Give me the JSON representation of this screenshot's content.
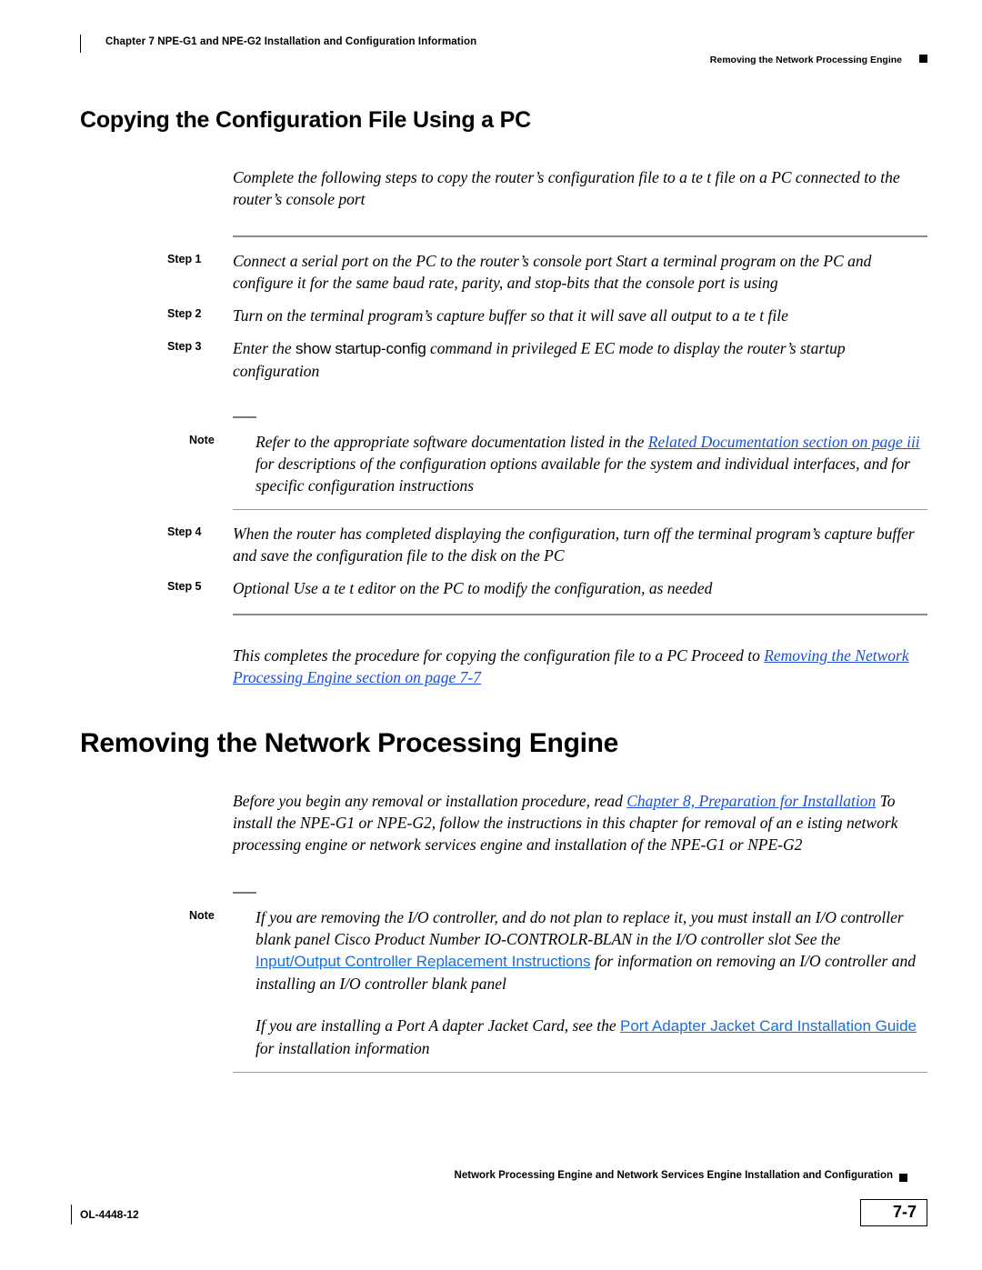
{
  "header": {
    "chapter": "Chapter 7      NPE-G1 and NPE-G2 Installation and Configuration Information",
    "running_head": "Removing the Network Processing Engine"
  },
  "section1": {
    "title": "Copying the Configuration File Using a PC",
    "intro": "Complete the following steps to copy the router’s configuration file to a te t file on a PC connected to the router’s console port",
    "steps": [
      {
        "label": "Step 1",
        "text": "Connect a serial port on the PC to the router’s console port  Start a terminal program on the PC and configure it for the same baud rate, parity, and stop-bits that the console port is using"
      },
      {
        "label": "Step 2",
        "text": "Turn on the terminal program’s capture buffer so that it will save all output to a te t file"
      },
      {
        "label": "Step 3",
        "text_lead": "Enter the ",
        "command": "show startup-config",
        "text_tail": " command in privileged E  EC mode to display the router’s startup configuration"
      },
      {
        "label": "Step 4",
        "text": "When the router has completed displaying the configuration, turn off the terminal program’s capture buffer and save the configuration file to the disk on the PC"
      },
      {
        "label": "Step 5",
        "text": " Optional  Use a te t editor on the PC to modify the configuration, as needed"
      }
    ],
    "note": {
      "label": "Note",
      "lead": "Refer to the appropriate software documentation listed in the ",
      "link": "Related Documentation  section on page iii",
      "tail": " for descriptions of the configuration options available for the system and individual interfaces, and for specific configuration instructions"
    },
    "closing": {
      "lead": "This completes the procedure for copying the configuration file to a PC  Proceed to ",
      "link": "Removing the Network Processing Engine  section on page 7-7"
    }
  },
  "section2": {
    "title": "Removing the Network Processing Engine",
    "intro_lead": "Before you begin any removal or installation procedure, read ",
    "intro_link": "Chapter 8,  Preparation for Installation",
    "intro_tail": "  To install the NPE-G1 or NPE-G2, follow the instructions in this chapter for removal of an e isting network processing engine or network services engine and installation of the NPE-G1 or NPE-G2",
    "note": {
      "label": "Note",
      "para1": "If you are removing the I/O controller, and do not plan to replace it, you must install an I/O controller blank panel  Cisco Product Number IO-CONTROLR-BLAN     in the I/O controller slot  See the ",
      "para1_link": "Input/Output Controller Replacement Instructions",
      "para1_tail": " for information on removing an I/O controller and installing an I/O controller blank panel",
      "para2_lead": "If you are installing a Port A dapter Jacket Card, see the ",
      "para2_link": "Port Adapter Jacket Card Installation Guide",
      "para2_tail": " for installation information"
    }
  },
  "footer": {
    "running": "Network Processing Engine and Network Services Engine Installation and Configuration",
    "doc_number": "OL-4448-12",
    "page_number": "7-7"
  },
  "colors": {
    "link_blue": "#1a4fd6",
    "link_sans_blue": "#1a6fd6",
    "rule_gray": "#8a8a8a"
  }
}
